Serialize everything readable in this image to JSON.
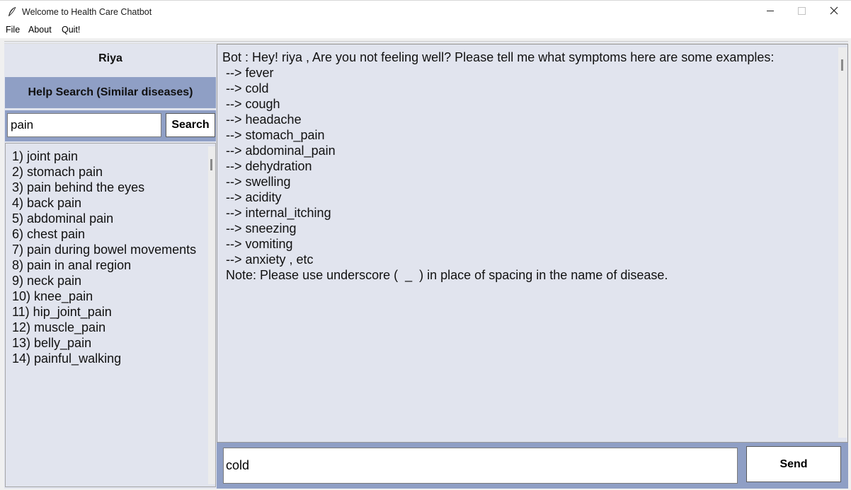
{
  "window": {
    "title": "Welcome to Health Care Chatbot",
    "icon": "feather-icon",
    "controls": [
      "minimize-icon",
      "maximize-icon",
      "close-icon"
    ]
  },
  "menu": {
    "items": [
      "File",
      "About",
      "Quit!"
    ]
  },
  "sidebar": {
    "username": "Riya",
    "help_header": "Help Search (Similar diseases)",
    "search": {
      "value": "pain",
      "button_label": "Search"
    },
    "results": [
      "1)  joint pain",
      "2)  stomach pain",
      "3)  pain behind the eyes",
      "4)  back pain",
      "5)  abdominal pain",
      "6)  chest pain",
      "7)  pain during bowel movements",
      "8)  pain in anal region",
      "9)  neck pain",
      "10)  knee_pain",
      "11)  hip_joint_pain",
      "12)  muscle_pain",
      "13)  belly_pain",
      "14)  painful_walking"
    ]
  },
  "chat": {
    "lines": [
      "Bot : Hey! riya , Are you not feeling well? Please tell me what symptoms here are some examples:",
      " --> fever",
      " --> cold",
      " --> cough",
      " --> headache",
      " --> stomach_pain",
      " --> abdominal_pain",
      " --> dehydration",
      " --> swelling",
      " --> acidity",
      " --> internal_itching",
      " --> sneezing",
      " --> vomiting",
      " --> anxiety , etc",
      " Note: Please use underscore (  _  ) in place of spacing in the name of disease."
    ],
    "input_value": "cold",
    "send_label": "Send"
  },
  "colors": {
    "panel_bg": "#e1e4ee",
    "accent": "#8f9fc5"
  }
}
